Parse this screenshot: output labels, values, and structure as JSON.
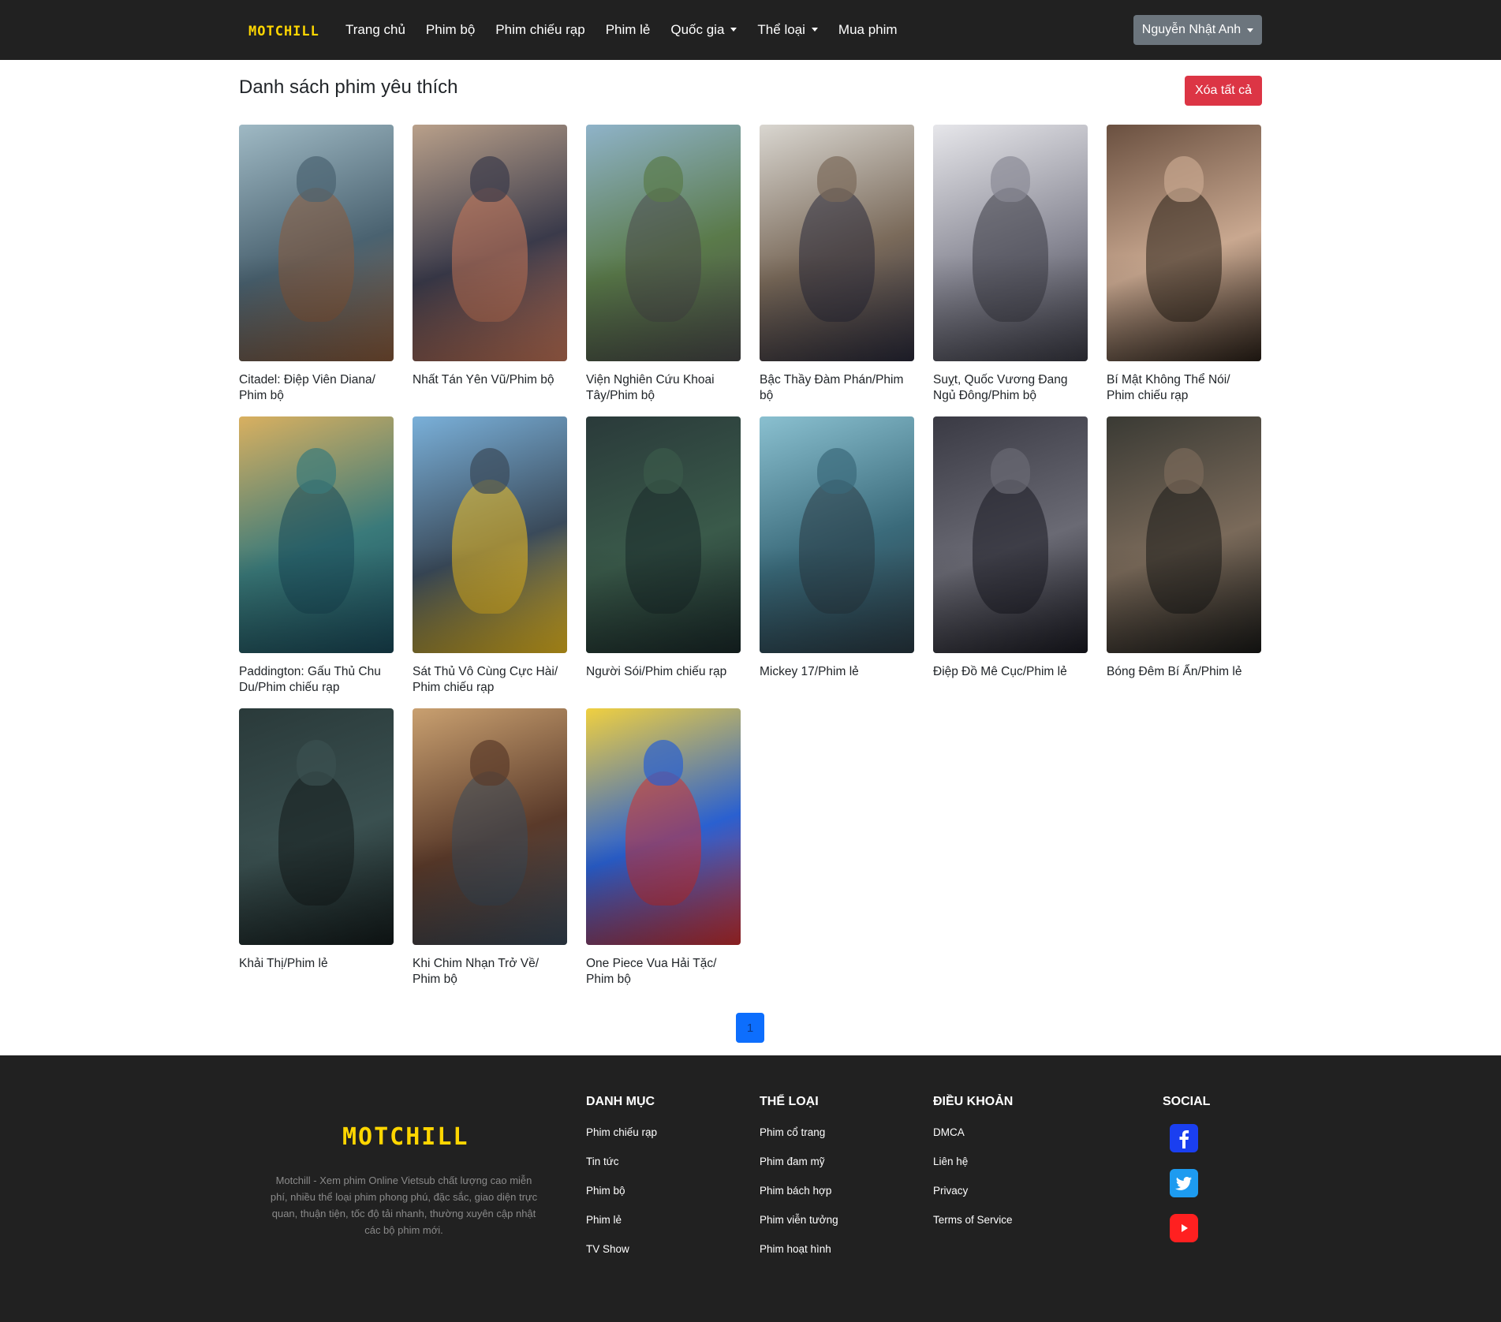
{
  "navbar": {
    "brand": "MOTCHILL",
    "links": [
      {
        "label": "Trang chủ",
        "dropdown": false
      },
      {
        "label": "Phim bộ",
        "dropdown": false
      },
      {
        "label": "Phim chiếu rạp",
        "dropdown": false
      },
      {
        "label": "Phim lẻ",
        "dropdown": false
      },
      {
        "label": "Quốc gia",
        "dropdown": true
      },
      {
        "label": "Thể loại",
        "dropdown": true
      },
      {
        "label": "Mua phim",
        "dropdown": false
      }
    ],
    "user": "Nguyễn Nhật Anh"
  },
  "main": {
    "title": "Danh sách phim yêu thích",
    "clear_all": "Xóa tất cả",
    "movies": [
      {
        "title": "Citadel: Điệp Viên Diana/ Phim bộ",
        "colors": [
          "#9fb9c4",
          "#4a6270",
          "#8a5a3a"
        ]
      },
      {
        "title": "Nhất Tán Yên Vũ/Phim bộ",
        "colors": [
          "#b9a08a",
          "#3a3a4a",
          "#c9785a"
        ]
      },
      {
        "title": "Viện Nghiên Cứu Khoai Tây/Phim bộ",
        "colors": [
          "#8fb3c9",
          "#5a7a4a",
          "#4a4a4a"
        ]
      },
      {
        "title": "Bậc Thầy Đàm Phán/Phim bộ",
        "colors": [
          "#d9d6d0",
          "#7a6a5a",
          "#2a2a3a"
        ]
      },
      {
        "title": "Suỵt, Quốc Vương Đang Ngủ Đông/Phim bộ",
        "colors": [
          "#e6e6ea",
          "#8a8a96",
          "#3a3a44"
        ]
      },
      {
        "title": "Bí Mật Không Thể Nói/ Phim chiếu rạp",
        "colors": [
          "#6a5040",
          "#c9a890",
          "#2a2018"
        ]
      },
      {
        "title": "Paddington: Gấu Thủ Chu Du/Phim chiếu rạp",
        "colors": [
          "#d9b060",
          "#3a7a7a",
          "#1a4a5a"
        ]
      },
      {
        "title": "Sát Thủ Vô Cùng Cực Hài/ Phim chiếu rạp",
        "colors": [
          "#7ab0d9",
          "#3a4a5a",
          "#f0c020"
        ]
      },
      {
        "title": "Người Sói/Phim chiếu rạp",
        "colors": [
          "#2a3a3a",
          "#3a5a4a",
          "#1a2a2a"
        ]
      },
      {
        "title": "Mickey 17/Phim lẻ",
        "colors": [
          "#8ac0d0",
          "#3a6a7a",
          "#2a3a44"
        ]
      },
      {
        "title": "Điệp Đồ Mê Cục/Phim lẻ",
        "colors": [
          "#3a3a44",
          "#6a6a74",
          "#1a1a22"
        ]
      },
      {
        "title": "Bóng Đêm Bí Ẩn/Phim lẻ",
        "colors": [
          "#3a3a34",
          "#7a6a5a",
          "#1a1a18"
        ]
      },
      {
        "title": "Khải Thị/Phim lẻ",
        "colors": [
          "#2a3a3a",
          "#3a5050",
          "#141c1c"
        ]
      },
      {
        "title": "Khi Chim Nhạn Trở Về/ Phim bộ",
        "colors": [
          "#c9a070",
          "#5a3a2a",
          "#3a4a5a"
        ]
      },
      {
        "title": "One Piece Vua Hải Tặc/ Phim bộ",
        "colors": [
          "#f0d040",
          "#2a60d0",
          "#d03030"
        ]
      }
    ],
    "pagination": [
      "1"
    ]
  },
  "footer": {
    "logo": "MOTCHILL",
    "description": "Motchill - Xem phim Online Vietsub chất lượng cao miễn phí, nhiều thể loại phim phong phú, đặc sắc, giao diện trực quan, thuận tiện, tốc độ tải nhanh, thường xuyên cập nhật các bộ phim mới.",
    "columns": [
      {
        "heading": "DANH MỤC",
        "links": [
          "Phim chiếu rạp",
          "Tin tức",
          "Phim bộ",
          "Phim lẻ",
          "TV Show"
        ]
      },
      {
        "heading": "THỂ LOẠI",
        "links": [
          "Phim cổ trang",
          "Phim đam mỹ",
          "Phim bách hợp",
          "Phim viễn tưởng",
          "Phim hoạt hình"
        ]
      },
      {
        "heading": "ĐIỀU KHOẢN",
        "links": [
          "DMCA",
          "Liên hệ",
          "Privacy",
          "Terms of Service"
        ]
      }
    ],
    "social": {
      "heading": "SOCIAL",
      "icons": [
        {
          "name": "facebook-icon",
          "color": "#1a3ff0"
        },
        {
          "name": "twitter-icon",
          "color": "#1d9bf0"
        },
        {
          "name": "youtube-icon",
          "color": "#ff2020"
        }
      ]
    }
  }
}
